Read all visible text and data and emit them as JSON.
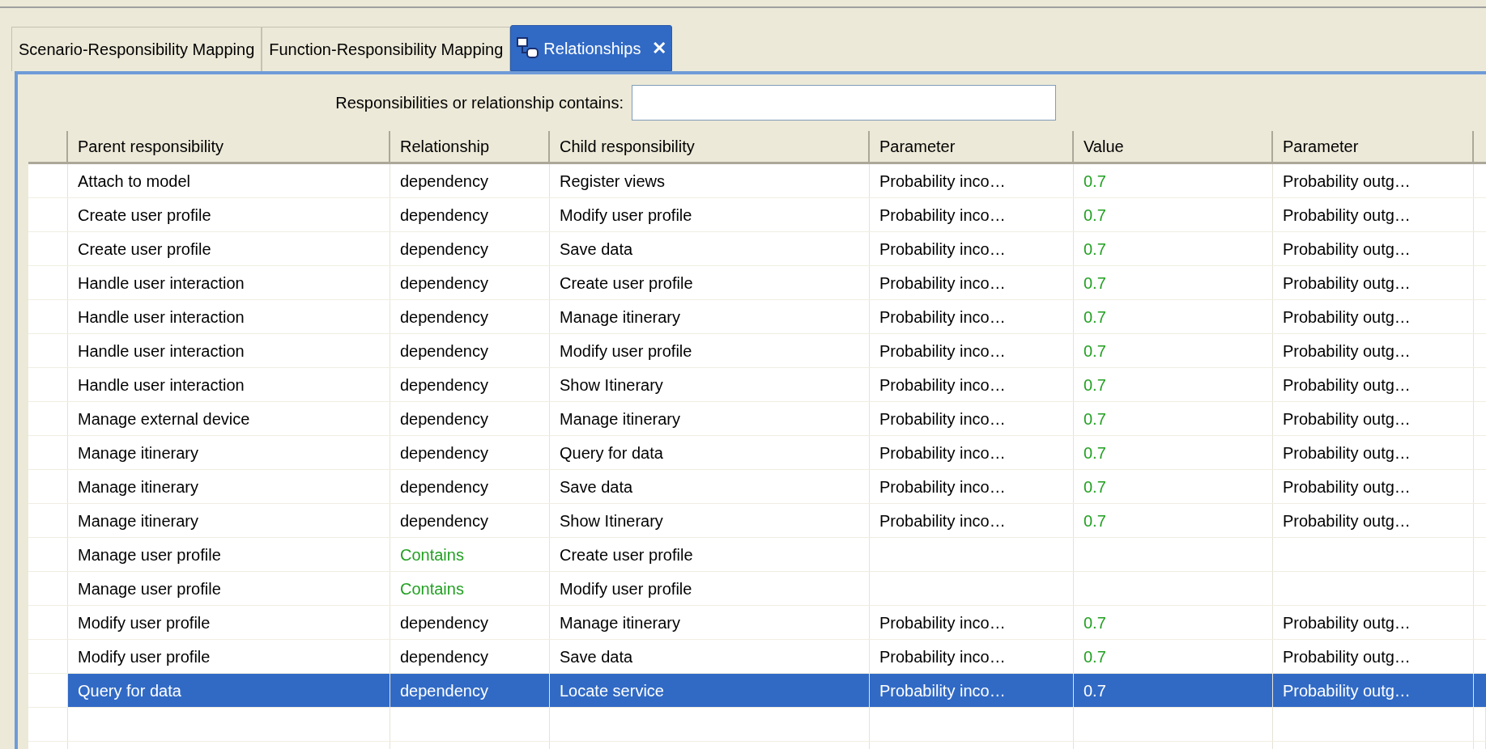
{
  "tabs": [
    {
      "label": "Scenario-Responsibility Mapping",
      "selected": false
    },
    {
      "label": "Function-Responsibility Mapping",
      "selected": false
    },
    {
      "label": "Relationships",
      "selected": true,
      "close": "✕"
    }
  ],
  "filter": {
    "label": "Responsibilities or relationship contains:"
  },
  "table": {
    "columns": [
      "Parent responsibility",
      "Relationship",
      "Child responsibility",
      "Parameter",
      "Value",
      "Parameter"
    ],
    "rows": [
      {
        "parent": "Attach to model",
        "relationship": {
          "text": "dependency",
          "color": "#000000"
        },
        "child": "Register views",
        "parameter_1": "Probability inco…",
        "value": {
          "text": "0.7",
          "color": "#22a022"
        },
        "parameter_2": "Probability outg…",
        "selected": false
      },
      {
        "parent": "Create user profile",
        "relationship": {
          "text": "dependency",
          "color": "#000000"
        },
        "child": "Modify user profile",
        "parameter_1": "Probability inco…",
        "value": {
          "text": "0.7",
          "color": "#22a022"
        },
        "parameter_2": "Probability outg…",
        "selected": false
      },
      {
        "parent": "Create user profile",
        "relationship": {
          "text": "dependency",
          "color": "#000000"
        },
        "child": "Save data",
        "parameter_1": "Probability inco…",
        "value": {
          "text": "0.7",
          "color": "#22a022"
        },
        "parameter_2": "Probability outg…",
        "selected": false
      },
      {
        "parent": "Handle user interaction",
        "relationship": {
          "text": "dependency",
          "color": "#000000"
        },
        "child": "Create user profile",
        "parameter_1": "Probability inco…",
        "value": {
          "text": "0.7",
          "color": "#22a022"
        },
        "parameter_2": "Probability outg…",
        "selected": false
      },
      {
        "parent": "Handle user interaction",
        "relationship": {
          "text": "dependency",
          "color": "#000000"
        },
        "child": "Manage itinerary",
        "parameter_1": "Probability inco…",
        "value": {
          "text": "0.7",
          "color": "#22a022"
        },
        "parameter_2": "Probability outg…",
        "selected": false
      },
      {
        "parent": "Handle user interaction",
        "relationship": {
          "text": "dependency",
          "color": "#000000"
        },
        "child": "Modify user profile",
        "parameter_1": "Probability inco…",
        "value": {
          "text": "0.7",
          "color": "#22a022"
        },
        "parameter_2": "Probability outg…",
        "selected": false
      },
      {
        "parent": "Handle user interaction",
        "relationship": {
          "text": "dependency",
          "color": "#000000"
        },
        "child": "Show Itinerary",
        "parameter_1": "Probability inco…",
        "value": {
          "text": "0.7",
          "color": "#22a022"
        },
        "parameter_2": "Probability outg…",
        "selected": false
      },
      {
        "parent": "Manage external device",
        "relationship": {
          "text": "dependency",
          "color": "#000000"
        },
        "child": "Manage itinerary",
        "parameter_1": "Probability inco…",
        "value": {
          "text": "0.7",
          "color": "#22a022"
        },
        "parameter_2": "Probability outg…",
        "selected": false
      },
      {
        "parent": "Manage itinerary",
        "relationship": {
          "text": "dependency",
          "color": "#000000"
        },
        "child": "Query for data",
        "parameter_1": "Probability inco…",
        "value": {
          "text": "0.7",
          "color": "#22a022"
        },
        "parameter_2": "Probability outg…",
        "selected": false
      },
      {
        "parent": "Manage itinerary",
        "relationship": {
          "text": "dependency",
          "color": "#000000"
        },
        "child": "Save data",
        "parameter_1": "Probability inco…",
        "value": {
          "text": "0.7",
          "color": "#22a022"
        },
        "parameter_2": "Probability outg…",
        "selected": false
      },
      {
        "parent": "Manage itinerary",
        "relationship": {
          "text": "dependency",
          "color": "#000000"
        },
        "child": "Show Itinerary",
        "parameter_1": "Probability inco…",
        "value": {
          "text": "0.7",
          "color": "#22a022"
        },
        "parameter_2": "Probability outg…",
        "selected": false
      },
      {
        "parent": "Manage user profile",
        "relationship": {
          "text": "Contains",
          "color": "#22a022"
        },
        "child": "Create user profile",
        "selected": false
      },
      {
        "parent": "Manage user profile",
        "relationship": {
          "text": "Contains",
          "color": "#22a022"
        },
        "child": "Modify user profile",
        "selected": false
      },
      {
        "parent": "Modify user profile",
        "relationship": {
          "text": "dependency",
          "color": "#000000"
        },
        "child": "Manage itinerary",
        "parameter_1": "Probability inco…",
        "value": {
          "text": "0.7",
          "color": "#22a022"
        },
        "parameter_2": "Probability outg…",
        "selected": false
      },
      {
        "parent": "Modify user profile",
        "relationship": {
          "text": "dependency",
          "color": "#000000"
        },
        "child": "Save data",
        "parameter_1": "Probability inco…",
        "value": {
          "text": "0.7",
          "color": "#22a022"
        },
        "parameter_2": "Probability outg…",
        "selected": false
      },
      {
        "parent": "Query for data",
        "relationship": {
          "text": "dependency"
        },
        "child": "Locate service",
        "parameter_1": "Probability inco…",
        "value": {
          "text": "0.7"
        },
        "parameter_2": "Probability outg…",
        "selected": true
      }
    ]
  }
}
